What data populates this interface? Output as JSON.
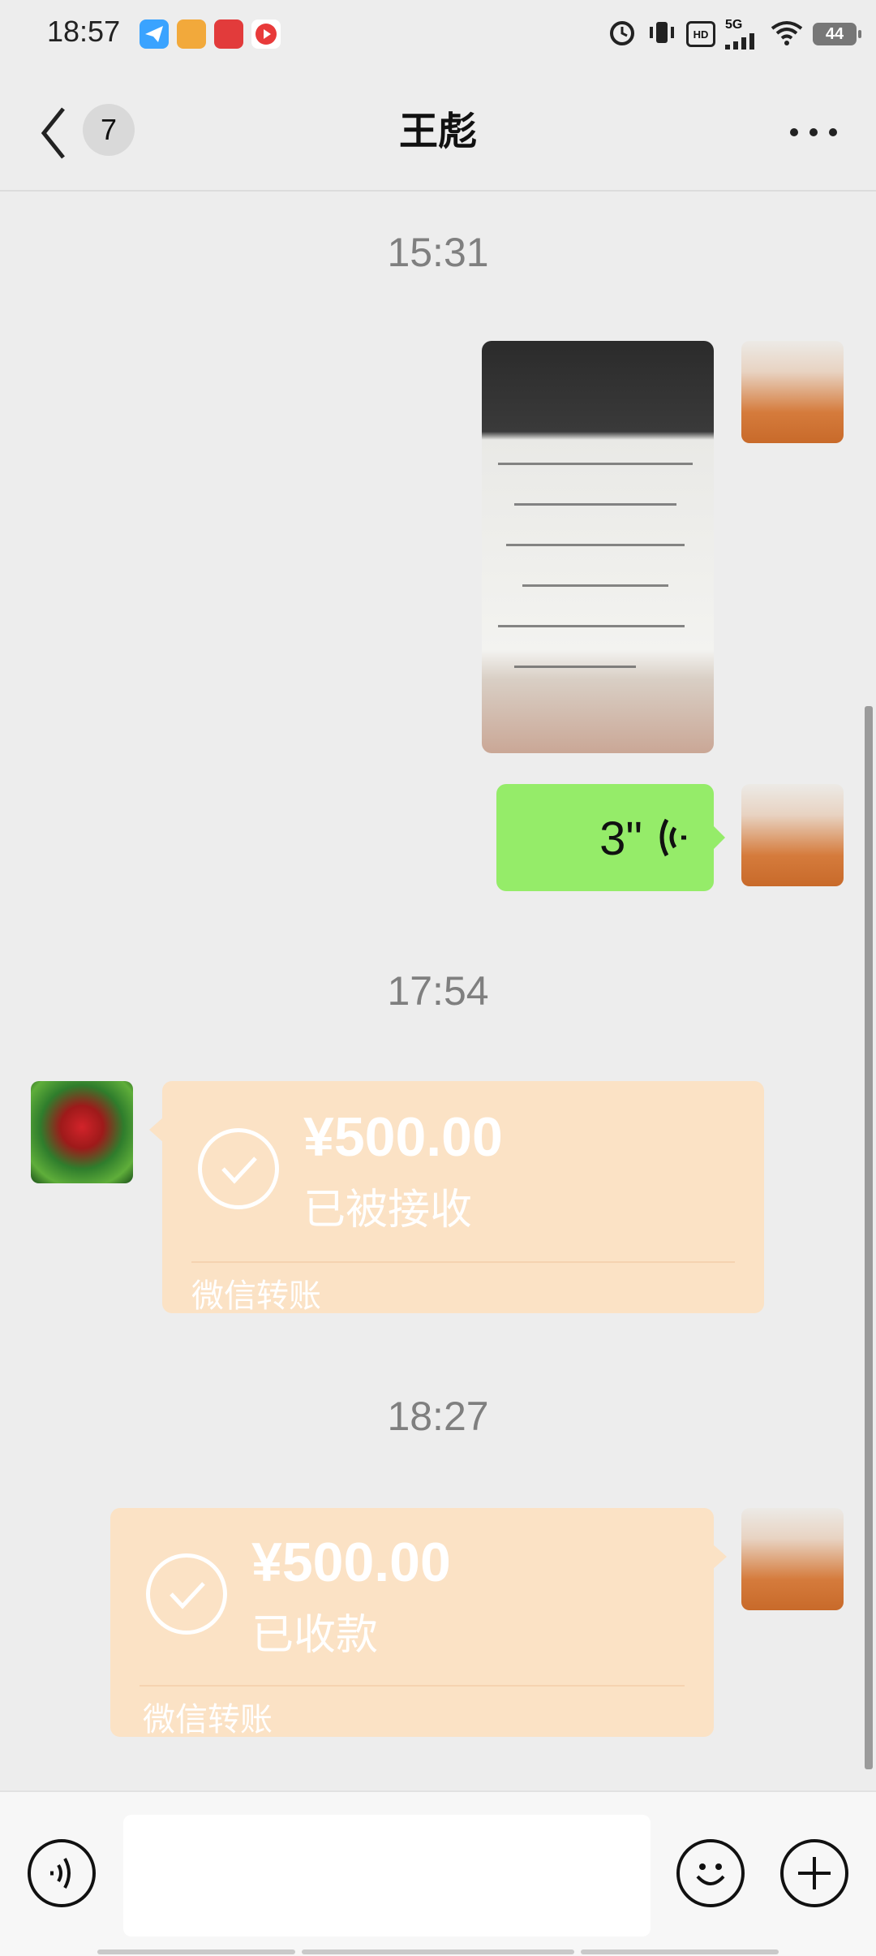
{
  "status_bar": {
    "time": "18:57",
    "battery": "44",
    "hd": "HD",
    "network": "5G",
    "app_icons": [
      "telegram-like",
      "news",
      "头条",
      "video"
    ]
  },
  "header": {
    "unread_count": "7",
    "contact_name": "王彪"
  },
  "messages": {
    "ts1": "15:31",
    "voice_duration": "3\"",
    "ts2": "17:54",
    "transfer_received": {
      "amount": "¥500.00",
      "status": "已被接收",
      "label": "微信转账"
    },
    "ts3": "18:27",
    "transfer_sent": {
      "amount": "¥500.00",
      "status": "已收款",
      "label": "微信转账"
    }
  },
  "colors": {
    "background": "#ededed",
    "voice_bubble": "#95ec69",
    "transfer_bubble": "#fbe2c5"
  }
}
